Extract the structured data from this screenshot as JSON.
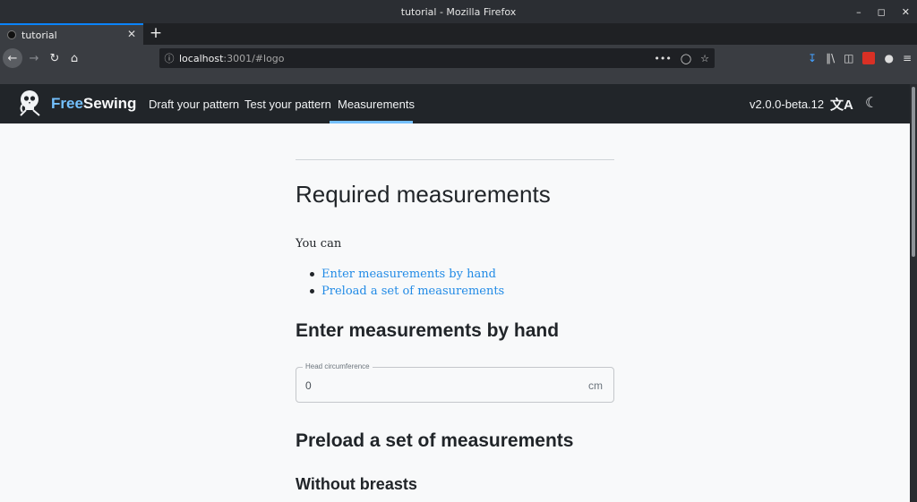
{
  "window": {
    "title": "tutorial - Mozilla Firefox"
  },
  "browser": {
    "tab_title": "tutorial",
    "url_host": "localhost",
    "url_path": ":3001/#logo"
  },
  "app": {
    "brand_free": "Free",
    "brand_sewing": "Sewing",
    "nav": [
      "Draft your pattern",
      "Test your pattern",
      "Measurements"
    ],
    "active_nav": "Measurements",
    "version": "v2.0.0-beta.12",
    "accent_color": "#74c0fc",
    "link_color": "#228be6"
  },
  "page": {
    "title": "Required measurements",
    "intro": "You can",
    "toc": [
      "Enter measurements by hand",
      "Preload a set of measurements"
    ],
    "section1_title": "Enter measurements by hand",
    "field": {
      "label": "Head circumference",
      "value": "0",
      "unit": "cm"
    },
    "section2_title": "Preload a set of measurements",
    "subsection_title": "Without breasts"
  }
}
